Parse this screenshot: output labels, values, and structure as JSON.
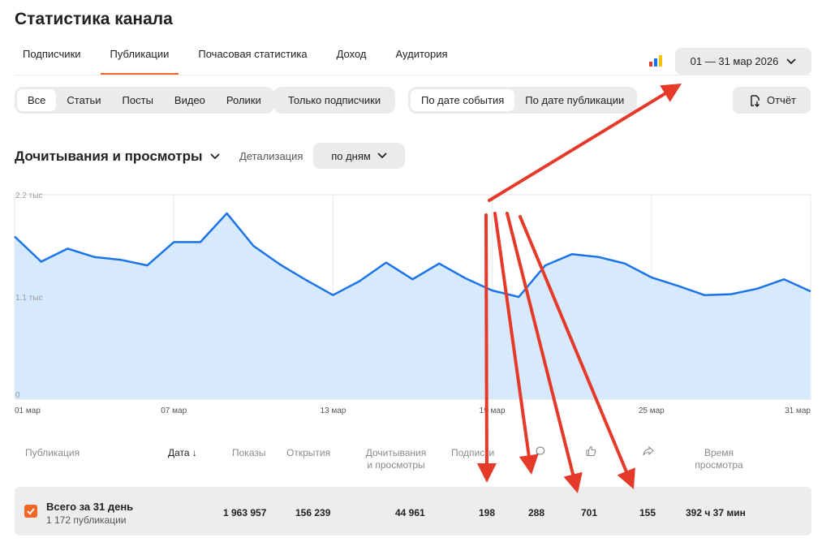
{
  "page_title": "Статистика канала",
  "tabs": [
    {
      "label": "Подписчики",
      "active": false
    },
    {
      "label": "Публикации",
      "active": true
    },
    {
      "label": "Почасовая статистика",
      "active": false
    },
    {
      "label": "Доход",
      "active": false
    },
    {
      "label": "Аудитория",
      "active": false
    }
  ],
  "date_range": "01 — 31 мар 2026",
  "type_filter": [
    "Все",
    "Статьи",
    "Посты",
    "Видео",
    "Ролики"
  ],
  "type_filter_selected": "Все",
  "subscribers_only": "Только подписчики",
  "date_mode": [
    "По дате события",
    "По дате публикации"
  ],
  "date_mode_selected": "По дате события",
  "report_label": "Отчёт",
  "metric_title": "Дочитывания и просмотры",
  "detail_label": "Детализация",
  "detail_value": "по дням",
  "chart_data": {
    "type": "area",
    "x": [
      "01 мар",
      "02 мар",
      "03 мар",
      "04 мар",
      "05 мар",
      "06 мар",
      "07 мар",
      "08 мар",
      "09 мар",
      "10 мар",
      "11 мар",
      "12 мар",
      "13 мар",
      "14 мар",
      "15 мар",
      "16 мар",
      "17 мар",
      "18 мар",
      "19 мар",
      "20 мар",
      "21 мар",
      "22 мар",
      "23 мар",
      "24 мар",
      "25 мар",
      "26 мар",
      "27 мар",
      "28 мар",
      "29 мар",
      "30 мар",
      "31 мар"
    ],
    "values": [
      1750,
      1480,
      1620,
      1530,
      1500,
      1440,
      1690,
      1690,
      2000,
      1650,
      1450,
      1280,
      1120,
      1270,
      1470,
      1290,
      1460,
      1300,
      1170,
      1100,
      1440,
      1560,
      1530,
      1460,
      1310,
      1220,
      1120,
      1130,
      1190,
      1290,
      1160
    ],
    "ylim": [
      0,
      2200
    ],
    "y_ticks": [
      "2.2 тыс",
      "1.1 тыс",
      "0"
    ],
    "x_tick_labels": [
      "01 мар",
      "07 мар",
      "13 мар",
      "19 мар",
      "25 мар",
      "31 мар"
    ],
    "grid": true,
    "line_color": "#1a73e8",
    "fill_color": "#d7e9fc"
  },
  "table": {
    "headers": {
      "publication": "Публикация",
      "date": "Дата",
      "impressions": "Показы",
      "opens": "Открытия",
      "reads_views_1": "Дочитывания",
      "reads_views_2": "и просмотры",
      "subscriptions": "Подписки",
      "time_1": "Время",
      "time_2": "просмотра"
    },
    "total": {
      "title": "Всего за 31 день",
      "subtitle": "1 172 публикации",
      "impressions": "1 963 957",
      "opens": "156 239",
      "reads_views": "44 961",
      "subscriptions": "198",
      "comments": "288",
      "likes": "701",
      "shares": "155",
      "watch_time": "392 ч 37 мин"
    }
  },
  "colors": {
    "accent": "#f26522",
    "arrow": "#e5392a"
  }
}
